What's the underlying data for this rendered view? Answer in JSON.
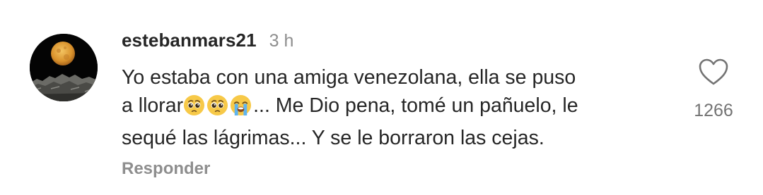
{
  "comment": {
    "username": "estebanmars21",
    "time": "3 h",
    "text_line1": "Yo estaba con una amiga venezolana, ella se puso",
    "text_line2_start": "a llorar",
    "emojis": [
      "pleading-face-emoji",
      "pleading-face-emoji",
      "loudly-crying-face-emoji"
    ],
    "text_line2_end": "... Me Dio pena, tomé un pañuelo, le",
    "text_line3": "sequé las lágrimas... Y se le borraron las cejas.",
    "reply_label": "Responder",
    "like_icon": "heart-outline-icon",
    "like_count": "1266"
  },
  "colors": {
    "text_primary": "#262626",
    "text_secondary": "#8e8e8e",
    "emoji_yellow": "#f7c948",
    "moon": "#e6a43a"
  }
}
